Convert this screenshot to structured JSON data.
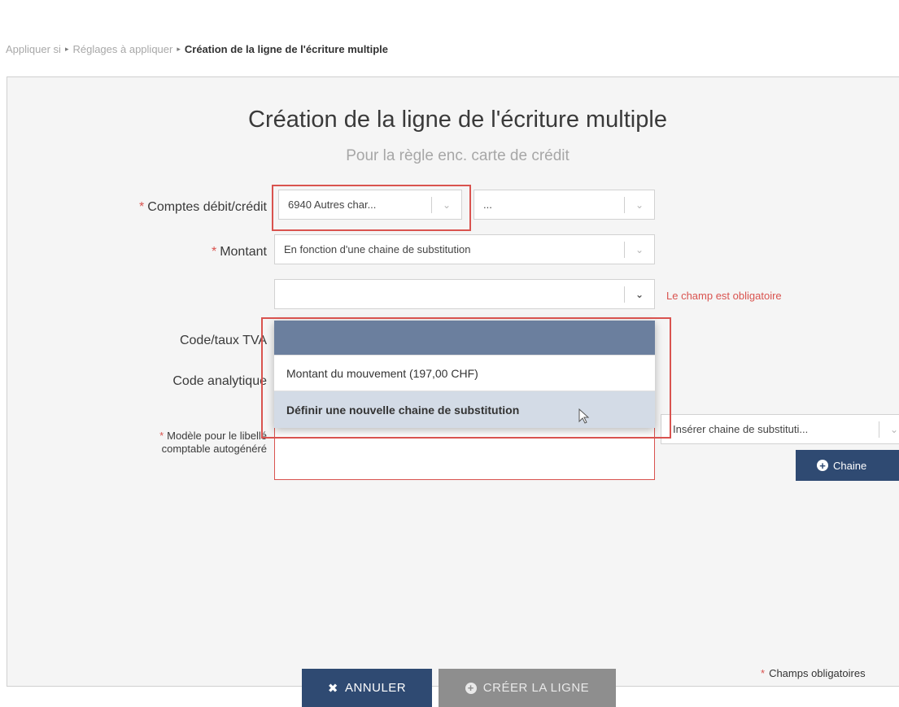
{
  "breadcrumb": {
    "items": [
      "Appliquer si",
      "Réglages à appliquer",
      "Création de la ligne de l'écriture multiple"
    ],
    "separator": "▸"
  },
  "form": {
    "title": "Création de la ligne de l'écriture multiple",
    "subtitle": "Pour la règle enc. carte de crédit",
    "required_marker": "*",
    "labels": {
      "accounts": "Comptes débit/crédit",
      "amount": "Montant",
      "vat": "Code/taux TVA",
      "analytic": "Code analytique",
      "template_line1": "Modèle pour le libellé",
      "template_line2": "comptable autogénéré"
    },
    "accounts_debit_value": "6940 Autres char...",
    "accounts_credit_value": "...",
    "amount_value": "En fonction d'une chaine de substitution",
    "substitution_value": "",
    "error_message": "Le champ est obligatoire",
    "insert_chain_value": "Insérer chaine de substituti...",
    "chain_button": "Chaine"
  },
  "dropdown": {
    "options": [
      "Montant du mouvement (197,00 CHF)",
      "Définir une nouvelle chaine de substitution"
    ],
    "highlighted_index": 1
  },
  "footer": {
    "cancel_label": "ANNULER",
    "create_label": "CRÉER LA LIGNE",
    "required_note": "Champs obligatoires"
  },
  "colors": {
    "primary": "#2f4a72",
    "error": "#d9534f",
    "disabled": "#8e8e8e",
    "dropdown_header": "#6b7f9e",
    "dropdown_highlight": "#d3dbe6"
  },
  "icons": {
    "chevron": "chevron-down-icon",
    "close": "close-icon",
    "plus": "plus-circle-icon",
    "cursor": "mouse-pointer-icon"
  }
}
